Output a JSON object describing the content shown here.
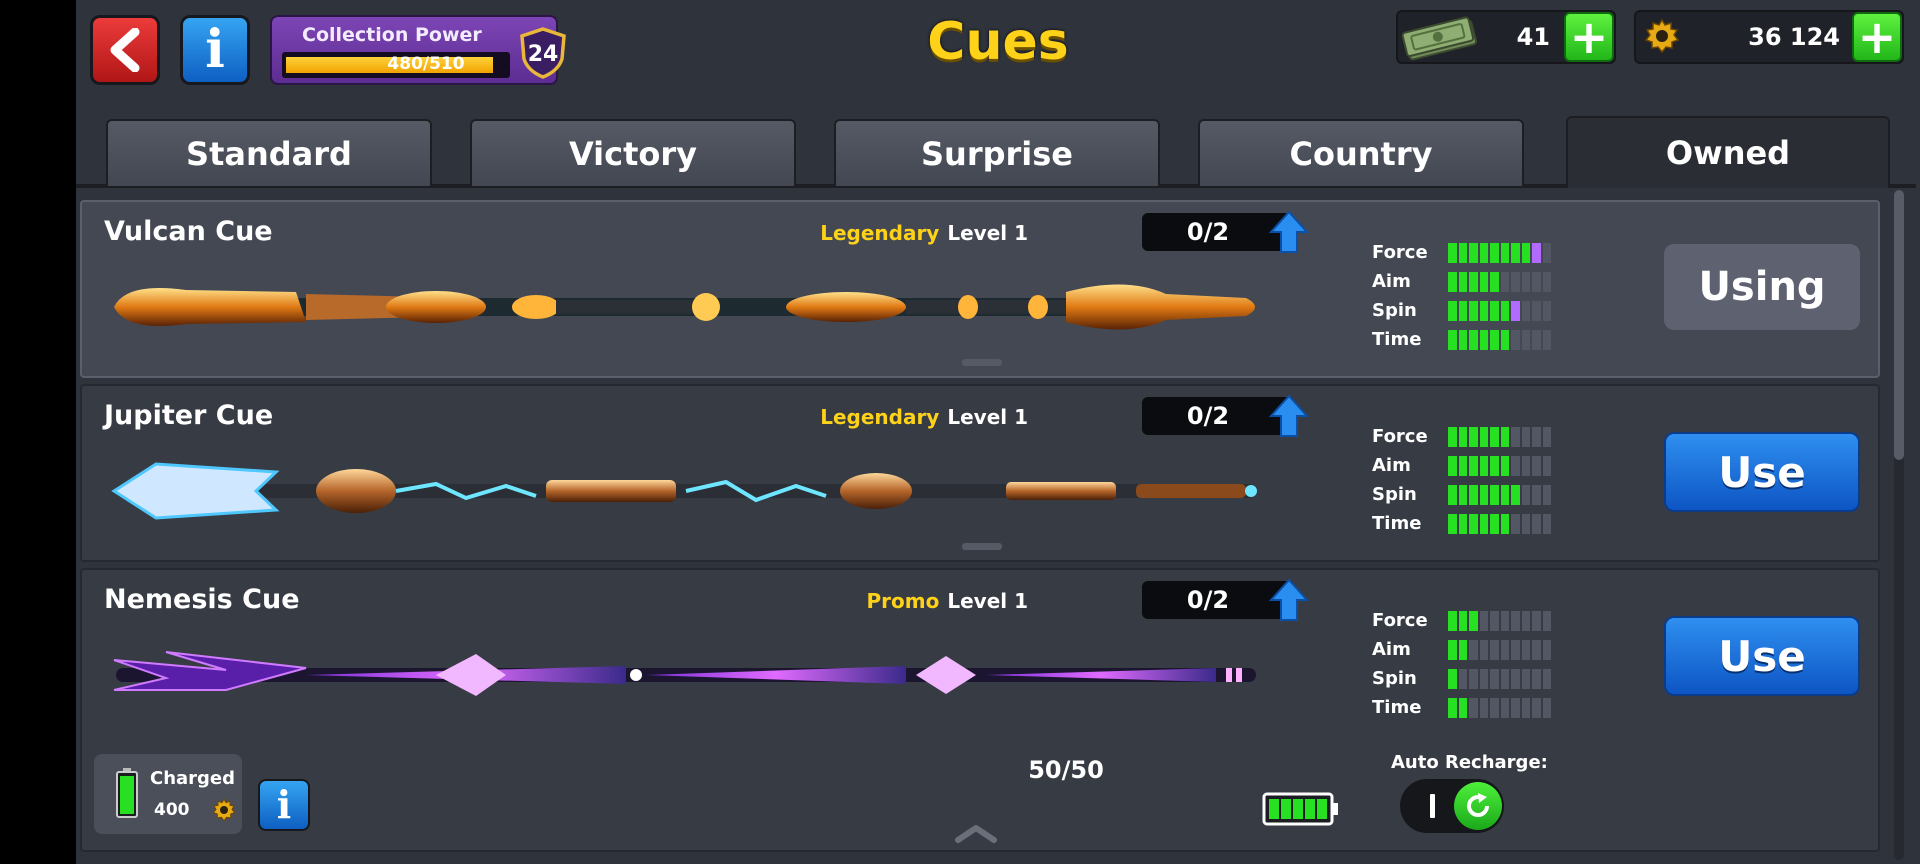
{
  "header": {
    "title": "Cues",
    "collection_power": {
      "label": "Collection Power",
      "value": "480/510",
      "progress": 0.94,
      "level": "24"
    },
    "cash": {
      "value": "41",
      "icon": "cash-icon"
    },
    "coins": {
      "value": "36 124",
      "icon": "coin-icon"
    }
  },
  "tabs": [
    {
      "label": "Standard",
      "active": false
    },
    {
      "label": "Victory",
      "active": false
    },
    {
      "label": "Surprise",
      "active": false
    },
    {
      "label": "Country",
      "active": false
    },
    {
      "label": "Owned",
      "active": true
    }
  ],
  "cues": [
    {
      "name": "Vulcan Cue",
      "rarity": "Legendary",
      "level": "Level 1",
      "pieces": "0/2",
      "action": "Using",
      "stats": [
        {
          "label": "Force",
          "value": 8,
          "extra": 1
        },
        {
          "label": "Aim",
          "value": 5,
          "extra": 0
        },
        {
          "label": "Spin",
          "value": 6,
          "extra": 1
        },
        {
          "label": "Time",
          "value": 6,
          "extra": 0
        }
      ]
    },
    {
      "name": "Jupiter Cue",
      "rarity": "Legendary",
      "level": "Level 1",
      "pieces": "0/2",
      "action": "Use",
      "stats": [
        {
          "label": "Force",
          "value": 6,
          "extra": 0
        },
        {
          "label": "Aim",
          "value": 6,
          "extra": 0
        },
        {
          "label": "Spin",
          "value": 7,
          "extra": 0
        },
        {
          "label": "Time",
          "value": 6,
          "extra": 0
        }
      ]
    },
    {
      "name": "Nemesis Cue",
      "rarity": "Promo",
      "level": "Level 1",
      "pieces": "0/2",
      "action": "Use",
      "stats": [
        {
          "label": "Force",
          "value": 3,
          "extra": 0
        },
        {
          "label": "Aim",
          "value": 2,
          "extra": 0
        },
        {
          "label": "Spin",
          "value": 1,
          "extra": 0
        },
        {
          "label": "Time",
          "value": 2,
          "extra": 0
        }
      ]
    }
  ],
  "bottom": {
    "charged_label": "Charged",
    "charged_cost": "400",
    "charges": "50/50",
    "auto_recharge_label": "Auto Recharge:"
  },
  "colors": {
    "rarity_gold": "#ffd21a",
    "stat_green": "#26e021",
    "stat_purple": "#b26bff",
    "use_blue": "#1a6fe0"
  }
}
